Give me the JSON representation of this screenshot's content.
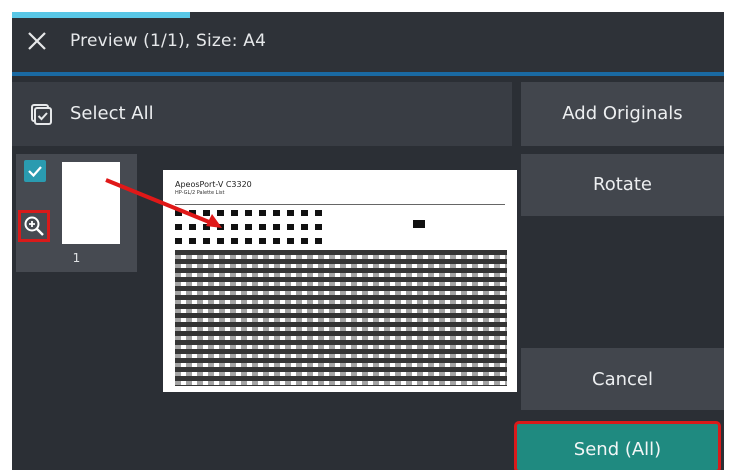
{
  "header": {
    "title": "Preview (1/1), Size: A4",
    "progress_fraction": 0.25
  },
  "toolbar": {
    "select_all_label": "Select All"
  },
  "actions": {
    "add_originals": "Add Originals",
    "rotate": "Rotate",
    "cancel": "Cancel",
    "send_all": "Send (All)"
  },
  "thumbnail": {
    "page_number": "1",
    "checked": true
  },
  "preview": {
    "doc_title": "ApeosPort-V C3320",
    "doc_subtitle": "HP-GL/2 Palette List"
  },
  "colors": {
    "accent": "#1a6aa3",
    "send": "#1f8a80",
    "highlight": "#d91a1a",
    "check": "#2a9bb0"
  },
  "icons": {
    "close": "close-icon",
    "select_all": "select-all-icon",
    "check": "check-icon",
    "zoom": "zoom-in-icon"
  }
}
